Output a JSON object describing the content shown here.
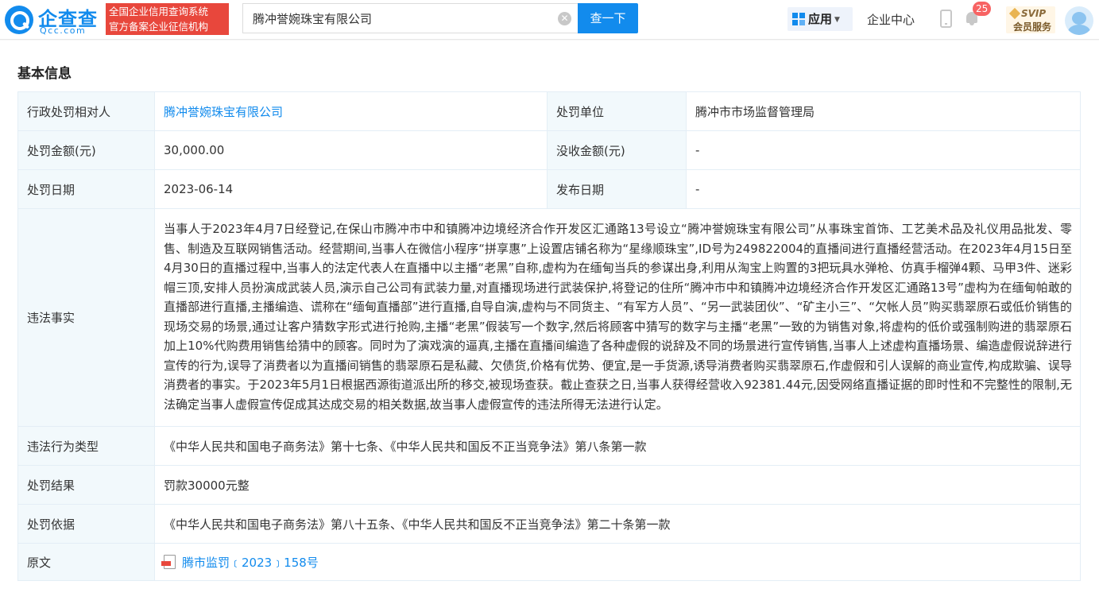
{
  "header": {
    "logo_name": "企查查",
    "logo_domain": "Qcc.com",
    "tagline_lines": [
      "全国企业信用查询系统",
      "官方备案企业征信机构"
    ],
    "search": {
      "value": "腾冲誉婉珠宝有限公司"
    },
    "search_button": "查一下",
    "app_menu": "应用",
    "enterprise_center": "企业中心",
    "notification_count": "25",
    "svip_label": "SVIP",
    "svip_sub": "会员服务",
    "icons": [
      "search-icon",
      "clear-icon",
      "app-grid-icon",
      "phone-icon",
      "bell-icon",
      "avatar"
    ]
  },
  "section": {
    "title": "基本信息"
  },
  "info": {
    "party_label": "行政处罚相对人",
    "party_value": "腾冲誉婉珠宝有限公司",
    "authority_label": "处罚单位",
    "authority_value": "腾冲市市场监督管理局",
    "fine_label": "处罚金额(元)",
    "fine_value": "30,000.00",
    "confiscation_label": "没收金额(元)",
    "confiscation_value": "-",
    "date_label": "处罚日期",
    "date_value": "2023-06-14",
    "publish_label": "发布日期",
    "publish_value": "-",
    "facts_label": "违法事实",
    "facts_value": "当事人于2023年4月7日经登记,在保山市腾冲市中和镇腾冲边境经济合作开发区汇通路13号设立“腾冲誉婉珠宝有限公司”从事珠宝首饰、工艺美术品及礼仪用品批发、零售、制造及互联网销售活动。经营期间,当事人在微信小程序“拼享惠”上设置店铺名称为“星缘顺珠宝”,ID号为249822004的直播间进行直播经营活动。在2023年4月15日至4月30日的直播过程中,当事人的法定代表人在直播中以主播“老黑”自称,虚构为在缅甸当兵的参谋出身,利用从淘宝上购置的3把玩具水弹枪、仿真手榴弹4颗、马甲3件、迷彩帽三顶,安排人员扮演成武装人员,演示自己公司有武装力量,对直播现场进行武装保护,将登记的住所“腾冲市中和镇腾冲边境经济合作开发区汇通路13号”虚构为在缅甸帕敢的直播部进行直播,主播编造、谎称在“缅甸直播部”进行直播,自导自演,虚构与不同货主、“有军方人员”、“另一武装团伙”、“矿主小三”、“欠帐人员”购买翡翠原石或低价销售的现场交易的场景,通过让客户猜数字形式进行抢购,主播“老黑”假装写一个数字,然后将顾客中猜写的数字与主播“老黑”一致的为销售对象,将虚构的低价或强制购进的翡翠原石加上10%代购费用销售给猜中的顾客。同时为了演戏演的逼真,主播在直播间编造了各种虚假的说辞及不同的场景进行宣传销售,当事人上述虚构直播场景、编造虚假说辞进行宣传的行为,误导了消费者以为直播间销售的翡翠原石是私藏、欠债货,价格有优势、便宜,是一手货源,诱导消费者购买翡翠原石,作虚假和引人误解的商业宣传,构成欺骗、误导消费者的事实。于2023年5月1日根据西源街道派出所的移交,被现场查获。截止查获之日,当事人获得经营收入92381.44元,因受网络直播证据的即时性和不完整性的限制,无法确定当事人虚假宣传促成其达成交易的相关数据,故当事人虚假宣传的违法所得无法进行认定。",
    "violation_type_label": "违法行为类型",
    "violation_type_value": "《中华人民共和国电子商务法》第十七条、《中华人民共和国反不正当竞争法》第八条第一款",
    "result_label": "处罚结果",
    "result_value": "罚款30000元整",
    "basis_label": "处罚依据",
    "basis_value": "《中华人民共和国电子商务法》第八十五条、《中华人民共和国反不正当竞争法》第二十条第一款",
    "original_label": "原文",
    "original_value": "腾市监罚﹝2023﹞158号"
  }
}
